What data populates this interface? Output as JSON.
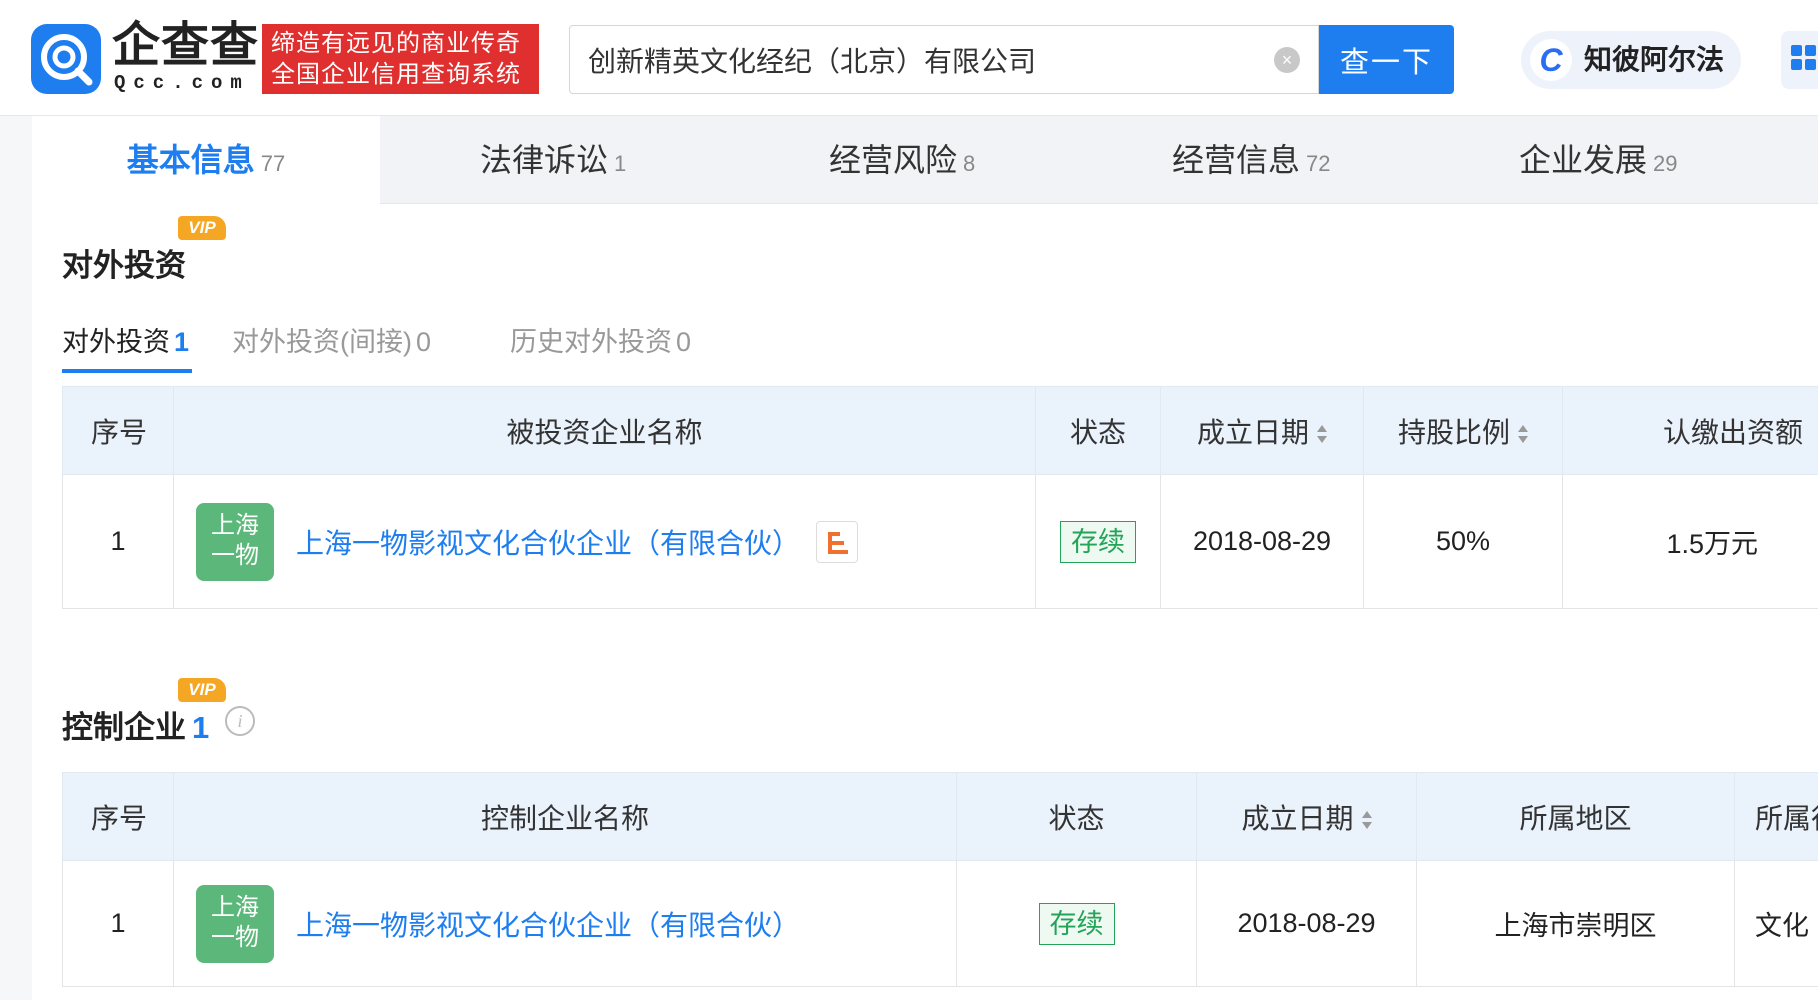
{
  "header": {
    "logo_cn": "企查查",
    "logo_en": "Qcc.com",
    "slogan_line1": "缔造有远见的商业传奇",
    "slogan_line2": "全国企业信用查询系统",
    "search_value": "创新精英文化经纪（北京）有限公司",
    "search_button": "查一下",
    "zhibi_label": "知彼阿尔法",
    "zhibi_glyph": "C"
  },
  "tabs": [
    {
      "label": "基本信息",
      "count": "77"
    },
    {
      "label": "法律诉讼",
      "count": "1"
    },
    {
      "label": "经营风险",
      "count": "8"
    },
    {
      "label": "经营信息",
      "count": "72"
    },
    {
      "label": "企业发展",
      "count": "29"
    }
  ],
  "vip_label": "VIP",
  "investment": {
    "title": "对外投资",
    "subtabs": [
      {
        "label": "对外投资",
        "count": "1"
      },
      {
        "label": "对外投资(间接)",
        "count": "0"
      },
      {
        "label": "历史对外投资",
        "count": "0"
      }
    ],
    "columns": [
      "序号",
      "被投资企业名称",
      "状态",
      "成立日期",
      "持股比例",
      "认缴出资额"
    ],
    "rows": [
      {
        "index": "1",
        "avatar_line1": "上海",
        "avatar_line2": "一物",
        "name": "上海一物影视文化合伙企业（有限合伙）",
        "status": "存续",
        "date": "2018-08-29",
        "ratio": "50%",
        "capital": "1.5万元"
      }
    ]
  },
  "control": {
    "title": "控制企业",
    "count": "1",
    "info_glyph": "i",
    "columns": [
      "序号",
      "控制企业名称",
      "状态",
      "成立日期",
      "所属地区",
      "所属行业"
    ],
    "rows": [
      {
        "index": "1",
        "avatar_line1": "上海",
        "avatar_line2": "一物",
        "name": "上海一物影视文化合伙企业（有限合伙）",
        "status": "存续",
        "date": "2018-08-29",
        "region": "上海市崇明区",
        "industry": "文化"
      }
    ]
  },
  "colors": {
    "accent": "#1e7ef0",
    "slogan_bg": "#e02f2f",
    "status_green": "#23a458",
    "vip": "#f5a623",
    "avatar": "#5cb87a"
  }
}
